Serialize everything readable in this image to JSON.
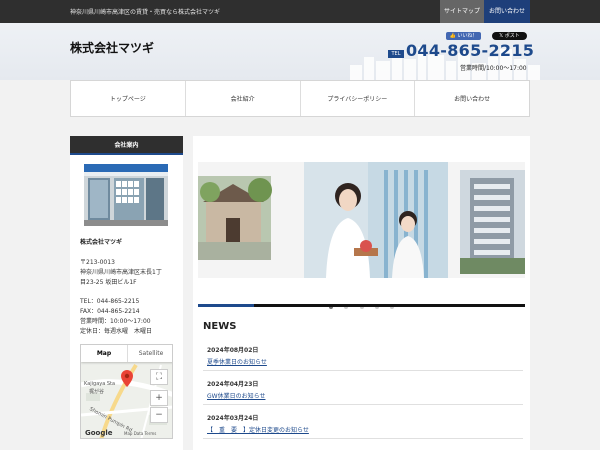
{
  "topbar": {
    "tagline": "神奈川県川崎市高津区の賃貸・売買なら株式会社マツギ",
    "sitemap": "サイトマップ",
    "contact": "お問い合わせ"
  },
  "header": {
    "title": "株式会社マツギ",
    "like_label": "いいね！",
    "post_label": "ポスト",
    "tel_label": "TEL",
    "tel_number": "044-865-2215",
    "hours": "営業時間/10:00～17:00"
  },
  "nav": {
    "items": [
      {
        "label": "トップページ"
      },
      {
        "label": "会社紹介"
      },
      {
        "label": "プライバシーポリシー"
      },
      {
        "label": "お問い合わせ"
      }
    ]
  },
  "sidebar": {
    "heading": "会社案内",
    "company": "株式会社マツギ",
    "postal": "〒213-0013",
    "address1": "神奈川県川崎市高津区末長1丁",
    "address2": "目23-25 坂田ビル1F",
    "tel": "TEL：044-865-2215",
    "fax": "FAX：044-865-2214",
    "hours": "営業時間：10:00～17:00",
    "holiday": "定休日：毎週水曜　木曜日"
  },
  "map": {
    "tab_map": "Map",
    "tab_satellite": "Satellite",
    "station_label": "Kajigaya Sta",
    "station_sub": "梶が谷",
    "road_label": "Shomin Pumpin Rd",
    "google": "Google",
    "footer": "Map Data  Terms",
    "colors": {
      "marker": "#ea4335"
    }
  },
  "slider": {
    "slide_count": 5,
    "active_index": 0,
    "progress": 0.17
  },
  "news": {
    "title": "NEWS",
    "items": [
      {
        "date": "2024年08月02日",
        "text": "夏季休業日のお知らせ"
      },
      {
        "date": "2024年04月23日",
        "text": "GW休業日のお知らせ"
      },
      {
        "date": "2024年03月24日",
        "text": "【　重　要　】定休日変更のお知らせ"
      }
    ]
  },
  "colors": {
    "accent": "#1e4a8c",
    "dark": "#2f2f2f"
  }
}
